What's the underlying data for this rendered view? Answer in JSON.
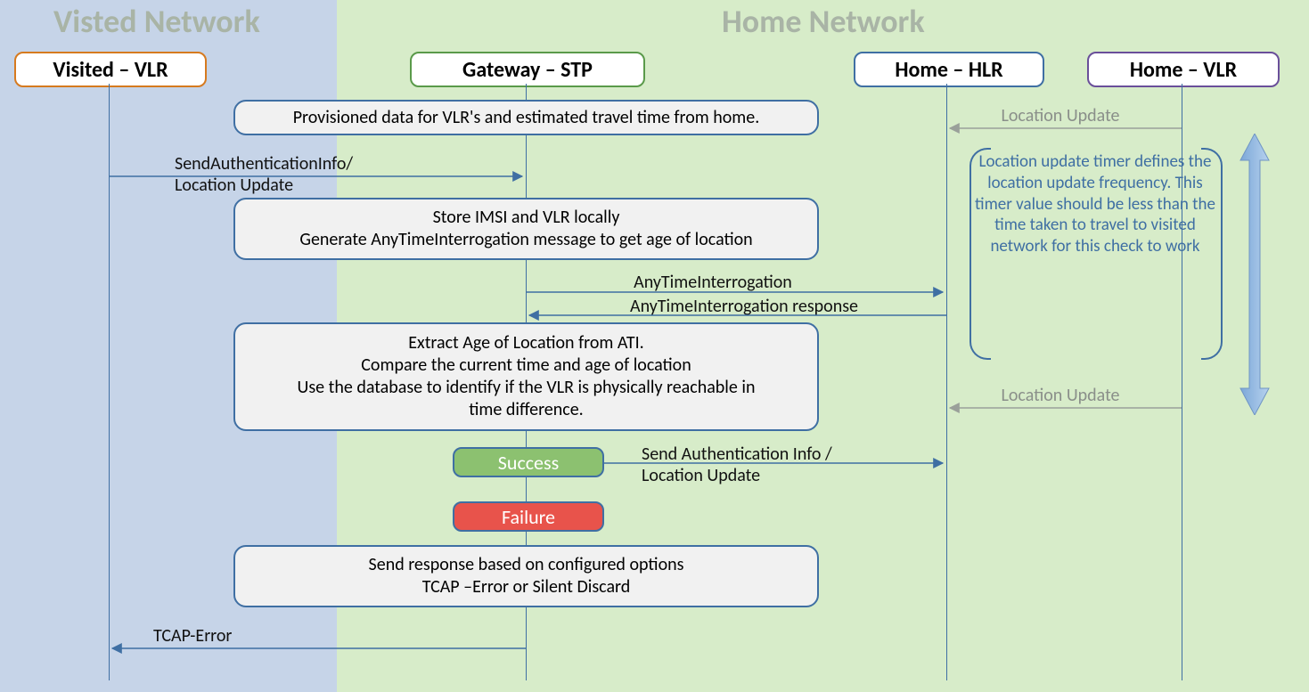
{
  "regions": {
    "visited_title": "Visted Network",
    "home_title": "Home Network"
  },
  "lanes": {
    "visited_vlr": "Visited – VLR",
    "gateway_stp": "Gateway – STP",
    "home_hlr": "Home – HLR",
    "home_vlr": "Home – VLR"
  },
  "messages": {
    "send_auth": "SendAuthenticationInfo/\nLocation Update",
    "ati": "AnyTimeInterrogation",
    "ati_resp": "AnyTimeInterrogation response",
    "send_auth2": "Send Authentication Info /\nLocation Update",
    "loc_update_top": "Location Update",
    "loc_update_bottom": "Location Update",
    "tcap_error": "TCAP-Error"
  },
  "notes": {
    "provisioned": "Provisioned data for VLR's and estimated travel time from home.",
    "store_imsi": "Store IMSI and VLR locally\nGenerate AnyTimeInterrogation message to get age of location",
    "extract_age": "Extract Age of Location from ATI.\nCompare the current time and age of location\nUse the database to identify if the VLR is physically reachable in\ntime difference.",
    "send_response": "Send response based on configured options\nTCAP –Error or Silent Discard",
    "timer_note": "Location update timer defines the location update frequency. This timer value should be less than the time taken to travel to visited network for this check to work"
  },
  "badges": {
    "success": "Success",
    "failure": "Failure"
  }
}
